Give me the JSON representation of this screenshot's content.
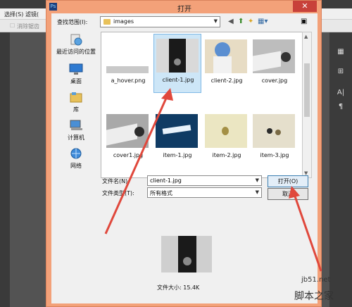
{
  "background_app": {
    "menu": [
      "选择(S)",
      "滤镜("
    ],
    "options_hint": "消除锯齿",
    "right_tools": [
      "A|",
      "¶"
    ]
  },
  "dialog": {
    "title": "打开",
    "close_label": "✕",
    "look_in_label": "查找范围(I):",
    "look_in_value": "images",
    "places": [
      {
        "label": "最近访问的位置",
        "icon": "recent-places-icon"
      },
      {
        "label": "桌面",
        "icon": "desktop-icon"
      },
      {
        "label": "库",
        "icon": "libraries-icon"
      },
      {
        "label": "计算机",
        "icon": "computer-icon"
      },
      {
        "label": "网络",
        "icon": "network-icon"
      }
    ],
    "files": [
      {
        "name": "a_hover.png",
        "selected": false
      },
      {
        "name": "client-1.jpg",
        "selected": true
      },
      {
        "name": "client-2.jpg",
        "selected": false
      },
      {
        "name": "cover.jpg",
        "selected": false
      },
      {
        "name": "cover1.jpg",
        "selected": false
      },
      {
        "name": "item-1.jpg",
        "selected": false
      },
      {
        "name": "item-2.jpg",
        "selected": false
      },
      {
        "name": "item-3.jpg",
        "selected": false
      }
    ],
    "file_name_label": "文件名(N):",
    "file_name_value": "client-1.jpg",
    "file_type_label": "文件类型(T):",
    "file_type_value": "所有格式",
    "open_button": "打开(O)",
    "cancel_button": "取消",
    "file_size_text": "文件大小: 15.4K"
  },
  "watermark": {
    "site": "jb51.net",
    "name": "脚本之家"
  },
  "colors": {
    "dialog_frame": "#f3a179",
    "selection": "#cde6f7",
    "arrow": "#e0483c"
  }
}
